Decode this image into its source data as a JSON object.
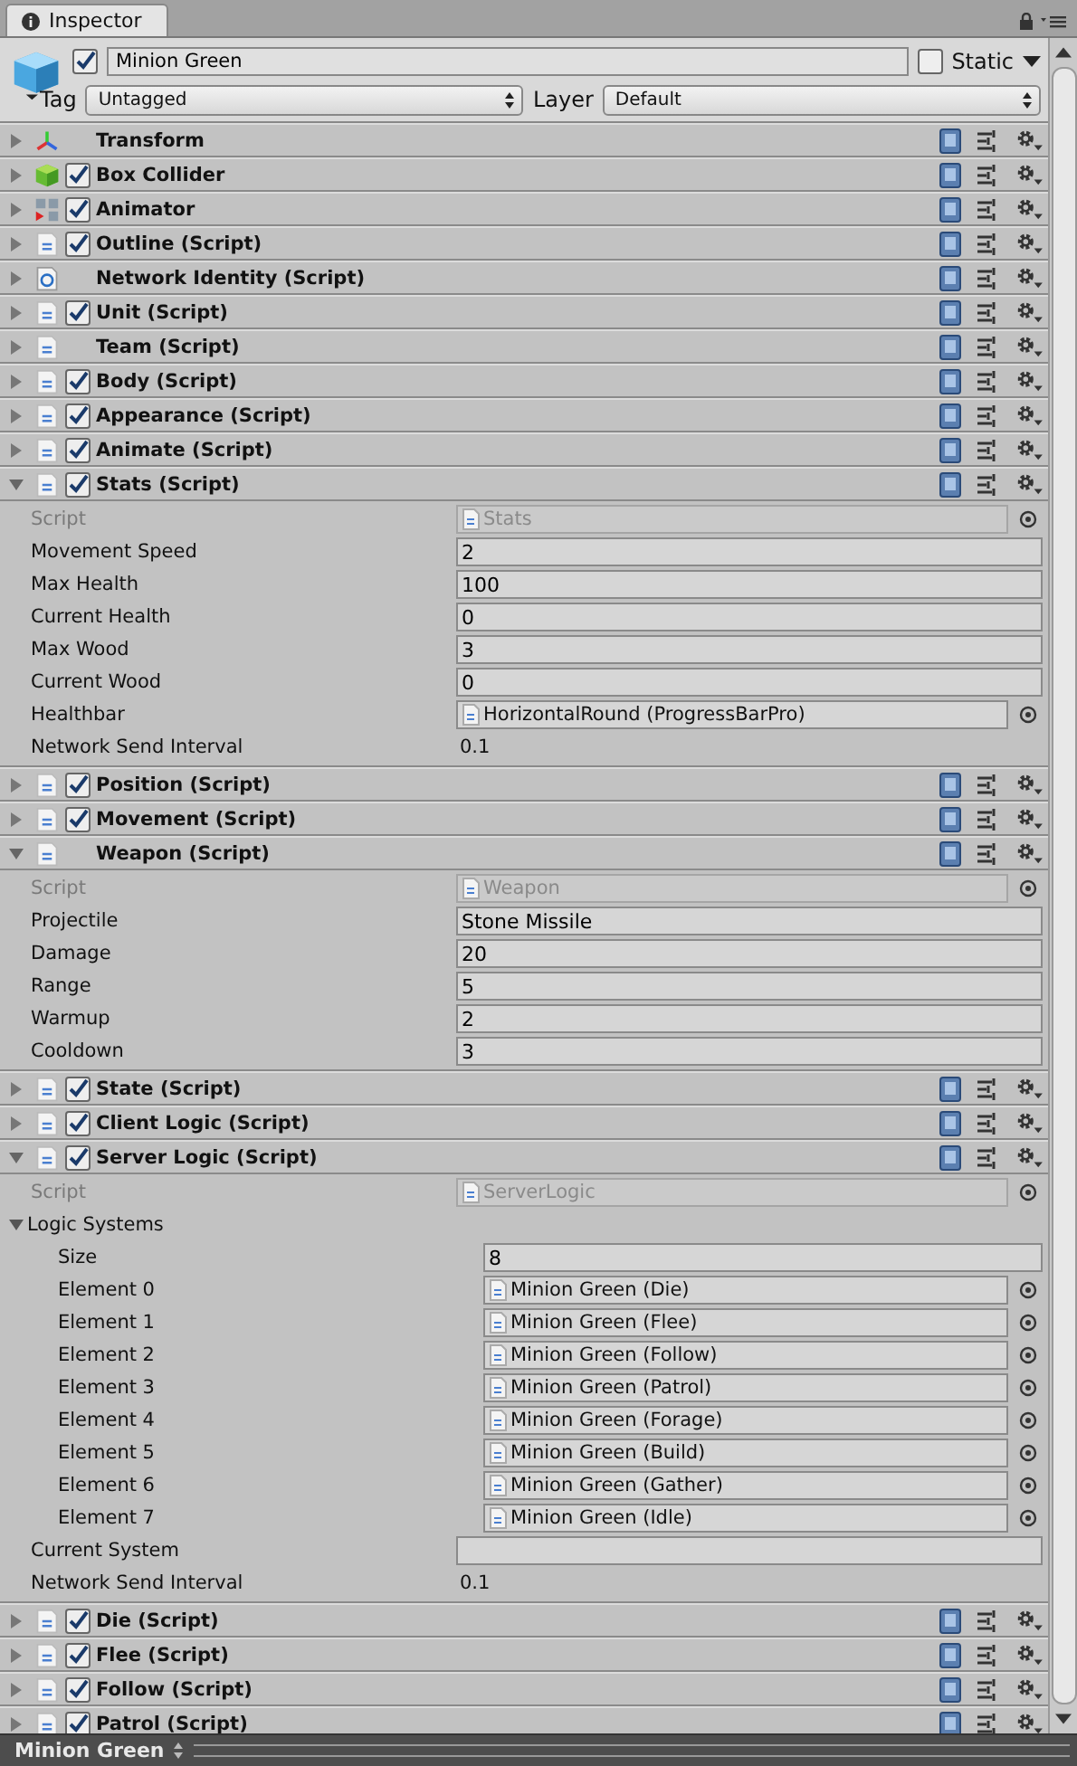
{
  "tab": {
    "label": "Inspector",
    "selected": true
  },
  "object": {
    "active": true,
    "name": "Minion Green",
    "static": false,
    "static_label": "Static",
    "tag_label": "Tag",
    "tag": "Untagged",
    "layer_label": "Layer",
    "layer": "Default"
  },
  "components": [
    {
      "kind": "transform",
      "name": "Transform",
      "expanded": false
    },
    {
      "kind": "collider",
      "name": "Box Collider",
      "checked": true,
      "expanded": false
    },
    {
      "kind": "animator",
      "name": "Animator",
      "checked": true,
      "expanded": false
    },
    {
      "kind": "script",
      "name": "Outline (Script)",
      "checked": true,
      "expanded": false
    },
    {
      "kind": "network",
      "name": "Network Identity (Script)",
      "expanded": false
    },
    {
      "kind": "script",
      "name": "Unit (Script)",
      "checked": true,
      "expanded": false
    },
    {
      "kind": "script",
      "name": "Team (Script)",
      "expanded": false
    },
    {
      "kind": "script",
      "name": "Body (Script)",
      "checked": true,
      "expanded": false
    },
    {
      "kind": "script",
      "name": "Appearance (Script)",
      "checked": true,
      "expanded": false
    },
    {
      "kind": "script",
      "name": "Animate (Script)",
      "checked": true,
      "expanded": false
    },
    {
      "kind": "script",
      "name": "Stats (Script)",
      "checked": true,
      "expanded": true,
      "fields": [
        {
          "kind": "script",
          "label": "Script",
          "value": "Stats"
        },
        {
          "kind": "text",
          "label": "Movement Speed",
          "value": "2"
        },
        {
          "kind": "text",
          "label": "Max Health",
          "value": "100"
        },
        {
          "kind": "text",
          "label": "Current Health",
          "value": "0"
        },
        {
          "kind": "text",
          "label": "Max Wood",
          "value": "3"
        },
        {
          "kind": "text",
          "label": "Current Wood",
          "value": "0"
        },
        {
          "kind": "object",
          "label": "Healthbar",
          "value": "HorizontalRound (ProgressBarPro)"
        },
        {
          "kind": "plain",
          "label": "Network Send Interval",
          "value": "0.1"
        }
      ]
    },
    {
      "kind": "script",
      "name": "Position (Script)",
      "checked": true,
      "expanded": false
    },
    {
      "kind": "script",
      "name": "Movement (Script)",
      "checked": true,
      "expanded": false
    },
    {
      "kind": "script",
      "name": "Weapon (Script)",
      "expanded": true,
      "fields": [
        {
          "kind": "script",
          "label": "Script",
          "value": "Weapon"
        },
        {
          "kind": "text",
          "label": "Projectile",
          "value": "Stone Missile"
        },
        {
          "kind": "text",
          "label": "Damage",
          "value": "20"
        },
        {
          "kind": "text",
          "label": "Range",
          "value": "5"
        },
        {
          "kind": "text",
          "label": "Warmup",
          "value": "2"
        },
        {
          "kind": "text",
          "label": "Cooldown",
          "value": "3"
        }
      ]
    },
    {
      "kind": "script",
      "name": "State (Script)",
      "checked": true,
      "expanded": false
    },
    {
      "kind": "script",
      "name": "Client Logic (Script)",
      "checked": true,
      "expanded": false
    },
    {
      "kind": "script",
      "name": "Server Logic (Script)",
      "checked": true,
      "expanded": true,
      "fields": [
        {
          "kind": "script",
          "label": "Script",
          "value": "ServerLogic"
        },
        {
          "kind": "foldout",
          "label": "Logic Systems",
          "expanded": true,
          "children": [
            {
              "kind": "text",
              "label": "Size",
              "value": "8"
            },
            {
              "kind": "object",
              "label": "Element 0",
              "value": "Minion Green (Die)"
            },
            {
              "kind": "object",
              "label": "Element 1",
              "value": "Minion Green (Flee)"
            },
            {
              "kind": "object",
              "label": "Element 2",
              "value": "Minion Green (Follow)"
            },
            {
              "kind": "object",
              "label": "Element 3",
              "value": "Minion Green (Patrol)"
            },
            {
              "kind": "object",
              "label": "Element 4",
              "value": "Minion Green (Forage)"
            },
            {
              "kind": "object",
              "label": "Element 5",
              "value": "Minion Green (Build)"
            },
            {
              "kind": "object",
              "label": "Element 6",
              "value": "Minion Green (Gather)"
            },
            {
              "kind": "object",
              "label": "Element 7",
              "value": "Minion Green (Idle)"
            }
          ]
        },
        {
          "kind": "text",
          "label": "Current System"
        },
        {
          "kind": "plain",
          "label": "Network Send Interval",
          "value": "0.1"
        }
      ]
    },
    {
      "kind": "script",
      "name": "Die (Script)",
      "checked": true,
      "expanded": false
    },
    {
      "kind": "script",
      "name": "Flee (Script)",
      "checked": true,
      "expanded": false
    },
    {
      "kind": "script",
      "name": "Follow (Script)",
      "checked": true,
      "expanded": false
    },
    {
      "kind": "script",
      "name": "Patrol (Script)",
      "checked": true,
      "expanded": false
    }
  ],
  "status_bar": {
    "label": "Minion Green"
  }
}
